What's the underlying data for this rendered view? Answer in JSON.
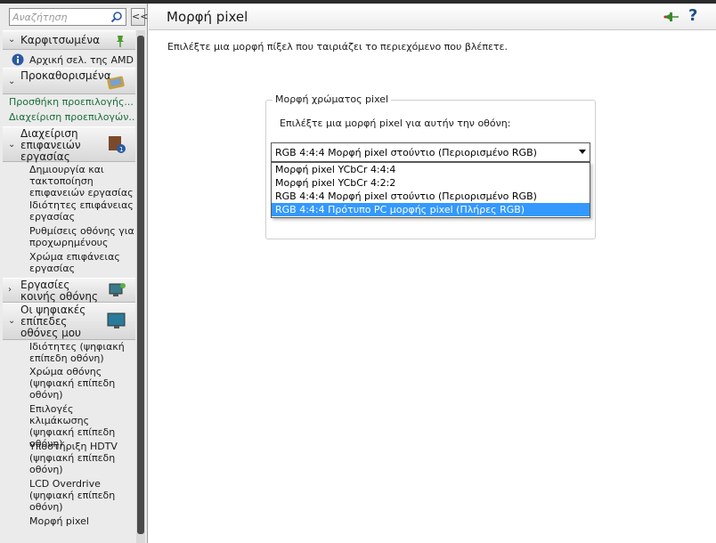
{
  "search": {
    "placeholder": "Αναζήτηση"
  },
  "collapse_label": "<<",
  "nav": {
    "pinned": "Καρφιτσωμένα",
    "amd_home": "Αρχική σελ. της AMD",
    "presets": "Προκαθορισμένα",
    "add_preset": "Προσθήκη προεπιλογής...",
    "manage_presets": "Διαχείριση προεπιλογών...",
    "desktop_mgmt": "Διαχείριση επιφανειών εργασίας",
    "desktop_subitems": [
      "Δημιουργία και τακτοποίηση επιφανειών εργασίας",
      "Ιδιότητες επιφάνειας εργασίας",
      "Ρυθμίσεις οθόνης για προχωρημένους",
      "Χρώμα επιφάνειας εργασίας"
    ],
    "common_display": "Εργασίες κοινής οθόνης",
    "flat_panels": "Οι ψηφιακές επίπεδες οθόνες μου",
    "flat_subitems": [
      "Ιδιότητες (ψηφιακή επίπεδη οθόνη)",
      "Χρώμα οθόνης (ψηφιακή επίπεδη οθόνη)",
      "Επιλογές κλιμάκωσης (ψηφιακή επίπεδη οθόνη)",
      "Υποστήριξη HDTV (ψηφιακή επίπεδη οθόνη)",
      "LCD Overdrive (ψηφιακή επίπεδη οθόνη)",
      "Μορφή pixel"
    ]
  },
  "main": {
    "title": "Μορφή pixel",
    "description": "Επιλέξτε μια μορφή πίξελ που ταιριάζει το περιεχόμενο που βλέπετε.",
    "group_title": "Μορφή χρώματος pixel",
    "prompt": "Επιλέξτε μια μορφή pixel για αυτήν την οθόνη:",
    "selected_value": "RGB 4:4:4 Μορφή pixel στούντιο (Περιορισμένο RGB)",
    "options": [
      "Μορφή pixel YCbCr 4:4:4",
      "Μορφή pixel YCbCr 4:2:2",
      "RGB 4:4:4 Μορφή pixel στούντιο (Περιορισμένο RGB)",
      "RGB 4:4:4 Πρότυπο PC μορφής pixel (Πλήρες RGB)"
    ],
    "highlighted_option_index": 3,
    "help_label": "?"
  },
  "colors": {
    "link": "#1a6e3a",
    "selection": "#3399ff",
    "help": "#1f4f8a"
  }
}
